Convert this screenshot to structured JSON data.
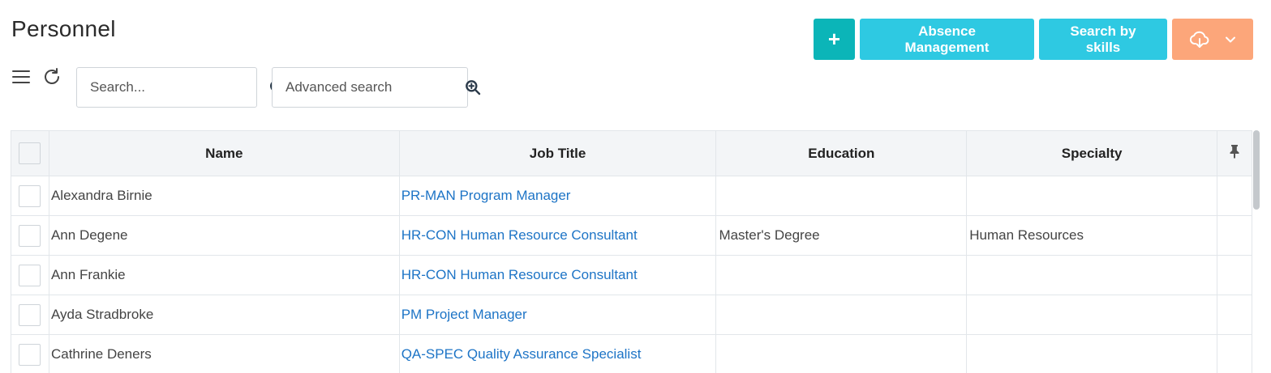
{
  "page": {
    "title": "Personnel"
  },
  "actions": {
    "add_label": "+",
    "absence_label": "Absence Management",
    "skills_label": "Search by skills",
    "colors": {
      "add": "#0bb5b8",
      "primary": "#2ec9e2",
      "export": "#fca67a"
    }
  },
  "toolbar": {
    "search": {
      "placeholder": "Search...",
      "value": ""
    },
    "advanced_search": {
      "placeholder": "Advanced search",
      "value": ""
    }
  },
  "icons": {
    "menu": "hamburger-icon",
    "refresh": "refresh-icon",
    "search": "search-icon",
    "advanced": "zoom-plus-icon",
    "export": "cloud-download-icon",
    "dropdown": "chevron-down-icon",
    "pin": "pin-icon"
  },
  "table": {
    "columns": [
      "Name",
      "Job Title",
      "Education",
      "Specialty"
    ],
    "rows": [
      {
        "name": "Alexandra Birnie",
        "job": "PR-MAN Program Manager",
        "education": "",
        "specialty": ""
      },
      {
        "name": "Ann Degene",
        "job": "HR-CON Human Resource Consultant",
        "education": "Master's Degree",
        "specialty": "Human Resources"
      },
      {
        "name": "Ann Frankie",
        "job": "HR-CON Human Resource Consultant",
        "education": "",
        "specialty": ""
      },
      {
        "name": "Ayda Stradbroke",
        "job": "PM Project Manager",
        "education": "",
        "specialty": ""
      },
      {
        "name": "Cathrine Deners",
        "job": "QA-SPEC Quality Assurance Specialist",
        "education": "",
        "specialty": ""
      }
    ],
    "link_color": "#1d74c6"
  }
}
